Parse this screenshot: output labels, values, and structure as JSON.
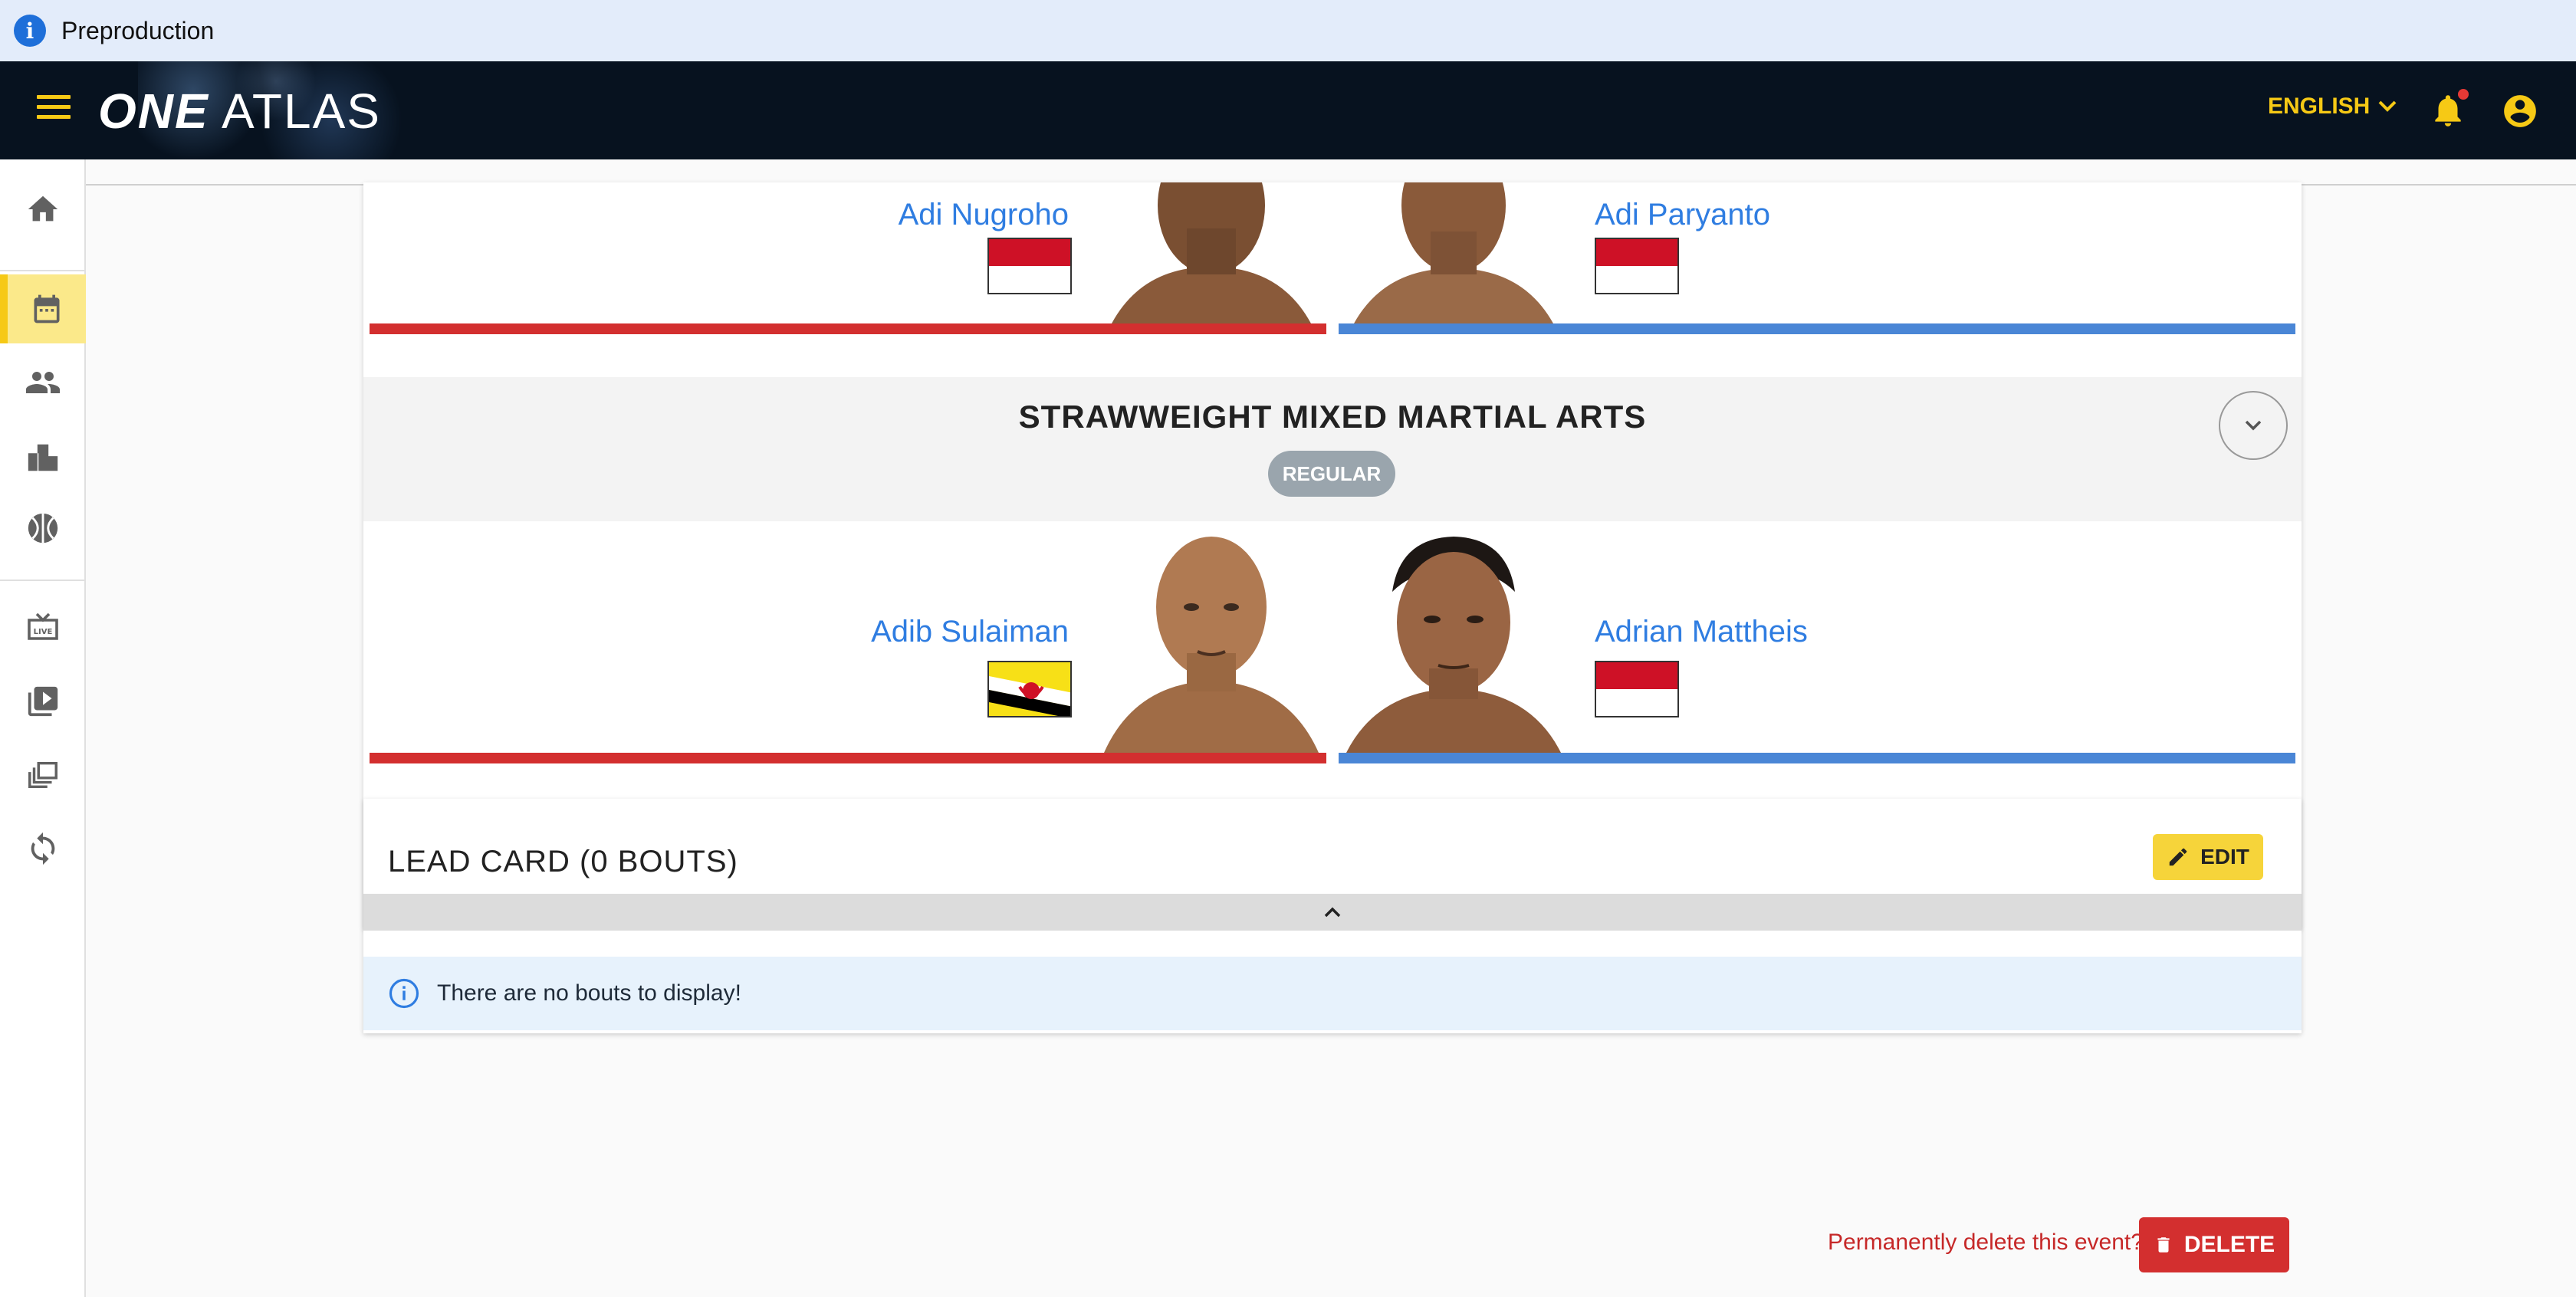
{
  "banner": {
    "icon": "info-icon",
    "text": "Preproduction"
  },
  "appbar": {
    "logo_one": "ONE",
    "logo_atlas": "ATLAS",
    "language": "ENGLISH",
    "icons": [
      "menu-icon",
      "bell-icon",
      "account-circle-icon"
    ],
    "accent_color": "#f6c915",
    "background_color": "#07121f"
  },
  "sidebar": {
    "items": [
      {
        "icon": "home-icon",
        "active": false
      },
      {
        "icon": "calendar-icon",
        "active": true
      },
      {
        "icon": "people-icon",
        "active": false
      },
      {
        "icon": "ranking-icon",
        "active": false
      },
      {
        "icon": "sports-ball-icon",
        "active": false
      },
      {
        "icon": "live-tv-icon",
        "active": false
      },
      {
        "icon": "video-library-icon",
        "active": false
      },
      {
        "icon": "collections-icon",
        "active": false
      },
      {
        "icon": "sync-icon",
        "active": false
      }
    ]
  },
  "bouts": [
    {
      "red": {
        "name": "Adi Nugroho",
        "flag": "Indonesia"
      },
      "blue": {
        "name": "Adi Paryanto",
        "flag": "Indonesia"
      }
    },
    {
      "title": "STRAWWEIGHT MIXED MARTIAL ARTS",
      "type": "REGULAR",
      "red": {
        "name": "Adib Sulaiman",
        "flag": "Brunei"
      },
      "blue": {
        "name": "Adrian Mattheis",
        "flag": "Indonesia"
      }
    }
  ],
  "lead_card": {
    "title": "LEAD CARD (0 BOUTS)",
    "edit_label": "EDIT",
    "empty_message": "There are no bouts to display!"
  },
  "danger": {
    "prompt": "Permanently delete this event?",
    "delete_label": "DELETE"
  },
  "colors": {
    "red_corner": "#d32f2f",
    "blue_corner": "#4a86d6",
    "link": "#2f7de1"
  }
}
